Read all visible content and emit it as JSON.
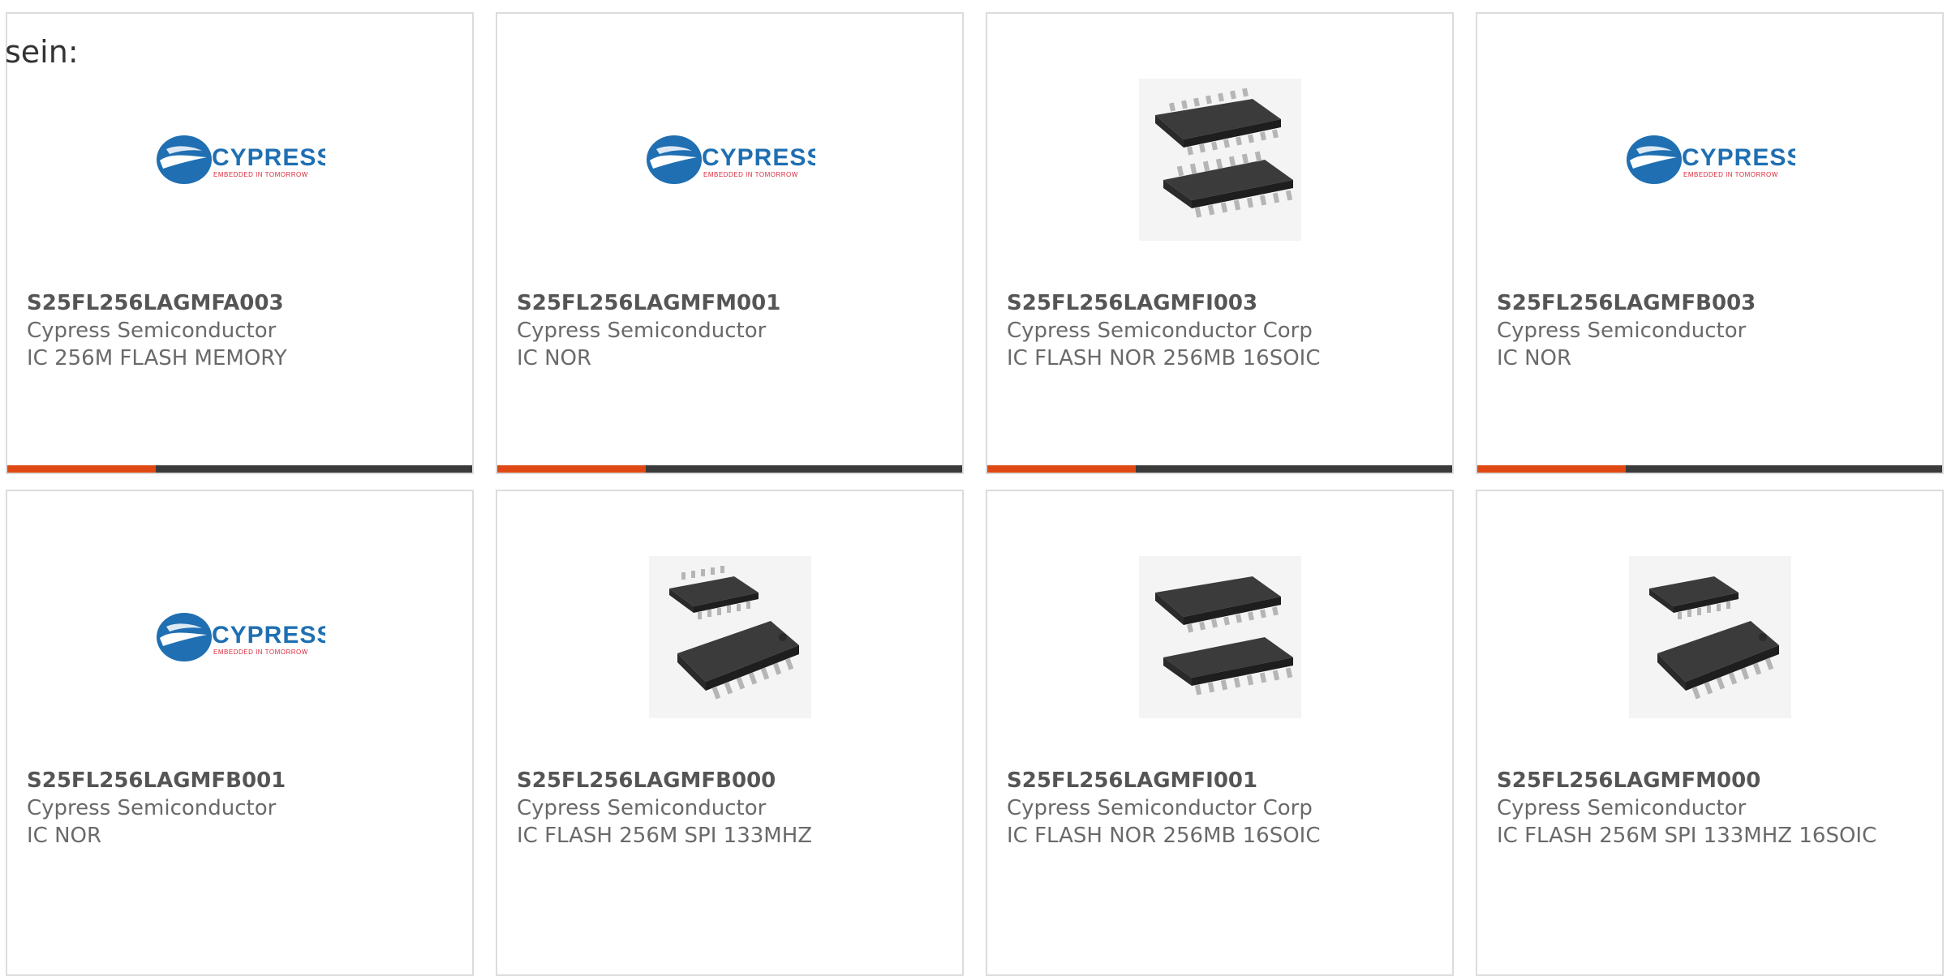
{
  "intro_text": "sein:",
  "colors": {
    "accent": "#e04813",
    "bar": "#3a3a3a",
    "logo_blue": "#1f6fb2",
    "logo_red": "#d92a3c"
  },
  "products": [
    {
      "part": "S25FL256LAGMFA003",
      "maker": "Cypress Semiconductor",
      "desc": "IC 256M FLASH MEMORY",
      "image": "cypress-logo"
    },
    {
      "part": "S25FL256LAGMFM001",
      "maker": "Cypress Semiconductor",
      "desc": "IC NOR",
      "image": "cypress-logo"
    },
    {
      "part": "S25FL256LAGMFI003",
      "maker": "Cypress Semiconductor Corp",
      "desc": "IC FLASH NOR 256MB 16SOIC",
      "image": "soic-chip"
    },
    {
      "part": "S25FL256LAGMFB003",
      "maker": "Cypress Semiconductor",
      "desc": "IC NOR",
      "image": "cypress-logo"
    },
    {
      "part": "S25FL256LAGMFB001",
      "maker": "Cypress Semiconductor",
      "desc": "IC NOR",
      "image": "cypress-logo"
    },
    {
      "part": "S25FL256LAGMFB000",
      "maker": "Cypress Semiconductor",
      "desc": "IC FLASH 256M SPI 133MHZ",
      "image": "soic-chip"
    },
    {
      "part": "S25FL256LAGMFI001",
      "maker": "Cypress Semiconductor Corp",
      "desc": "IC FLASH NOR 256MB 16SOIC",
      "image": "soic-chip"
    },
    {
      "part": "S25FL256LAGMFM000",
      "maker": "Cypress Semiconductor",
      "desc": "IC FLASH 256M SPI 133MHZ 16SOIC",
      "image": "soic-chip"
    }
  ]
}
